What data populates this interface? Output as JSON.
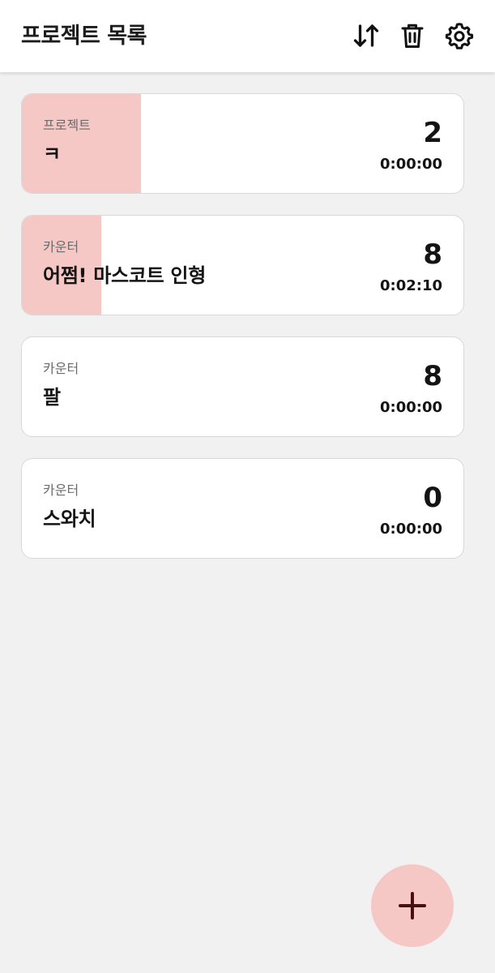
{
  "app_bar": {
    "title": "프로젝트 목록",
    "icons": [
      "sort-icon",
      "trash-icon",
      "settings-gear-icon"
    ]
  },
  "projects": [
    {
      "type": "프로젝트",
      "name": "ㅋ",
      "count": "2",
      "time": "0:00:00",
      "progress": 0.27
    },
    {
      "type": "카운터",
      "name": "어쩜! 마스코트 인형",
      "count": "8",
      "time": "0:02:10",
      "progress": 0.18
    },
    {
      "type": "카운터",
      "name": "팔",
      "count": "8",
      "time": "0:00:00",
      "progress": 0
    },
    {
      "type": "카운터",
      "name": "스와치",
      "count": "0",
      "time": "0:00:00",
      "progress": 0
    }
  ],
  "fab": {
    "icon": "plus-icon"
  },
  "colors": {
    "accent": "#f6c8c5",
    "fab_icon": "#4a0f0f",
    "background": "#f1f1f1",
    "card": "#ffffff",
    "text": "#141414"
  }
}
